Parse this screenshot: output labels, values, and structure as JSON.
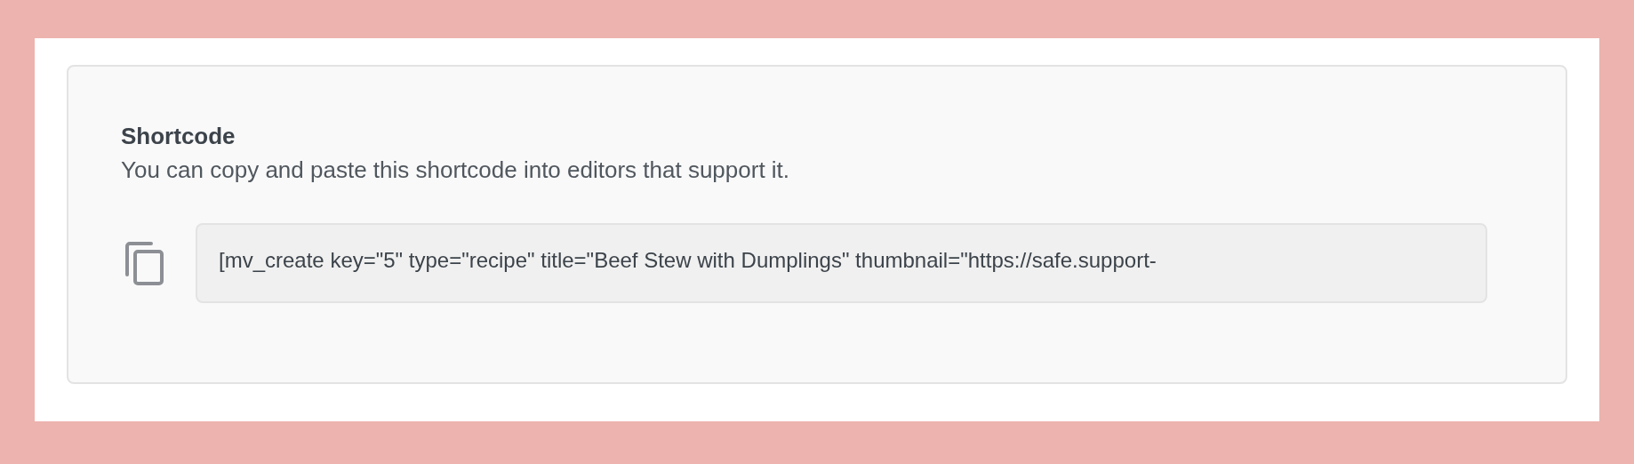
{
  "section": {
    "title": "Shortcode",
    "description": "You can copy and paste this shortcode into editors that support it.",
    "shortcode": "[mv_create key=\"5\" type=\"recipe\" title=\"Beef Stew with Dumplings\" thumbnail=\"https://safe.support-"
  }
}
